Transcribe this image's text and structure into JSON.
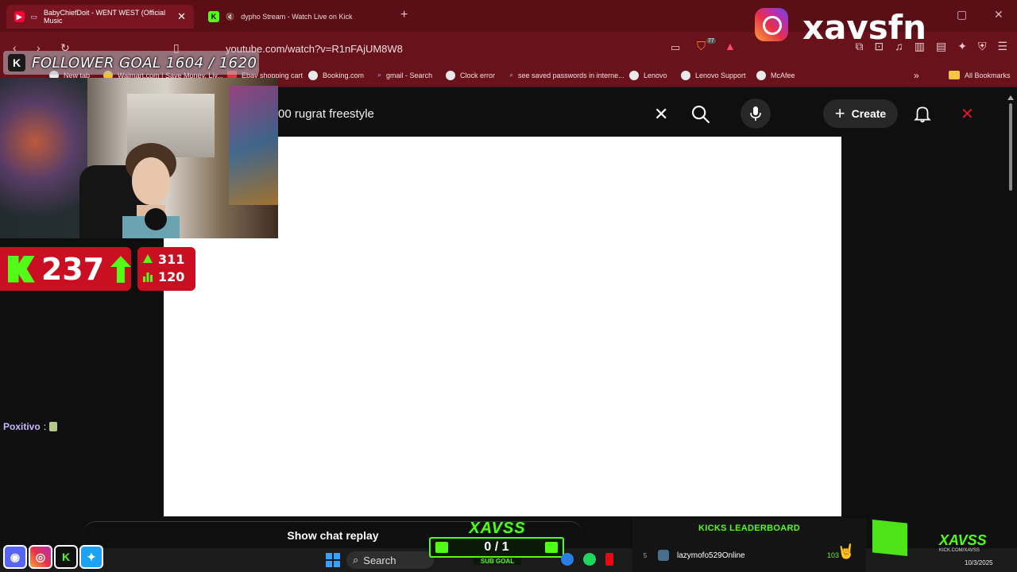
{
  "browser": {
    "tabs": [
      {
        "title": "BabyChiefDoit - WENT WEST (Official Music",
        "active": true
      },
      {
        "title": "dypho Stream - Watch Live on Kick",
        "active": false
      }
    ],
    "url": "youtube.com/watch?v=R1nFAjUM8W8",
    "bookmarks": [
      {
        "label": "New tab"
      },
      {
        "label": "Walmart.com | Save Money. Liv..."
      },
      {
        "label": "Ebay shopping cart"
      },
      {
        "label": "Booking.com"
      },
      {
        "label": "gmail - Search"
      },
      {
        "label": "Clock error"
      },
      {
        "label": "see saved passwords in interne..."
      },
      {
        "label": "Lenovo"
      },
      {
        "label": "Lenovo Support"
      },
      {
        "label": "McAfee"
      }
    ],
    "all_bookmarks": "All Bookmarks",
    "shield_badge": "77"
  },
  "youtube": {
    "search_value": "00 rugrat freestyle",
    "create_label": "Create"
  },
  "overlay": {
    "follower_goal": "FOLLOWER GOAL 1604 / 1620",
    "kick_count": "237",
    "stat_up": "311",
    "stat_bar": "120",
    "ig_handle": "xavsfn",
    "chat": {
      "user": "Poxitivo",
      "sep": ":"
    },
    "chat_replay": "Show chat replay",
    "sub_goal": {
      "brand": "XAVSS",
      "count": "0 / 1",
      "label": "SUB GOAL"
    },
    "leaderboard": {
      "title": "KICKS LEADERBOARD",
      "entries": [
        {
          "rank": "5",
          "name": "lazymofo529Online",
          "value": "103"
        }
      ]
    },
    "brand_right": {
      "name": "XAVSS",
      "sub": "KICK.COM/XAVSS"
    }
  },
  "taskbar": {
    "search_label": "Search",
    "date": "10/3/2025"
  },
  "colors": {
    "kick_green": "#53fc18",
    "overlay_red": "#c90f22",
    "chrome_red": "#6a121c"
  }
}
